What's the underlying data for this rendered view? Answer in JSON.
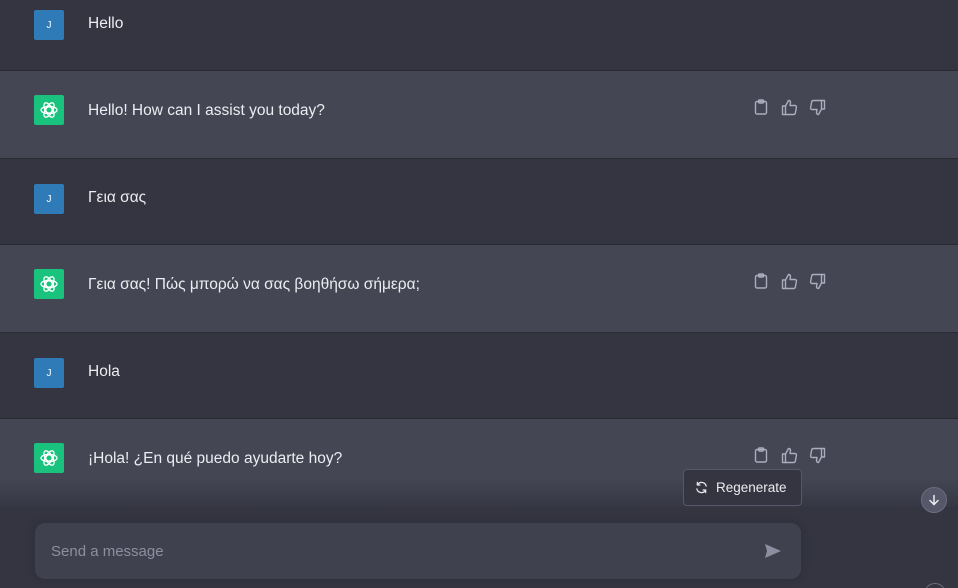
{
  "conversation": {
    "messages": [
      {
        "role": "user",
        "avatar_letter": "J",
        "text": "Hello"
      },
      {
        "role": "assistant",
        "text": "Hello! How can I assist you today?"
      },
      {
        "role": "user",
        "avatar_letter": "J",
        "text": "Γεια σας"
      },
      {
        "role": "assistant",
        "text": "Γεια σας! Πώς μπορώ να σας βοηθήσω σήμερα;"
      },
      {
        "role": "user",
        "avatar_letter": "J",
        "text": "Hola"
      },
      {
        "role": "assistant",
        "text": "¡Hola! ¿En qué puedo ayudarte hoy?"
      }
    ]
  },
  "controls": {
    "regenerate_label": "Regenerate"
  },
  "composer": {
    "placeholder": "Send a message"
  },
  "icons": {
    "user_avatar": "user-avatar-icon",
    "assistant_avatar": "openai-logo-icon",
    "copy": "clipboard-icon",
    "like": "thumbs-up-icon",
    "dislike": "thumbs-down-icon",
    "regenerate": "refresh-icon",
    "send": "send-icon",
    "scroll_down": "arrow-down-icon"
  },
  "colors": {
    "user_row_bg": "#343541",
    "assistant_row_bg": "#444654",
    "user_avatar_bg": "#2e7bb8",
    "assistant_avatar_bg": "#19c37d",
    "input_bg": "#40414f"
  }
}
